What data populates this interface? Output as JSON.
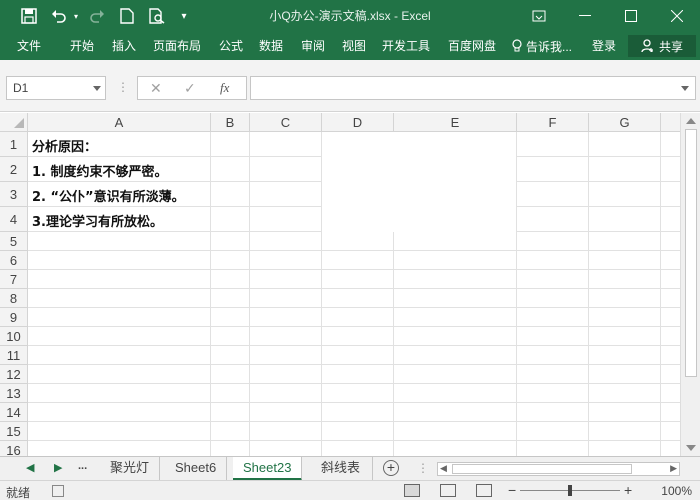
{
  "window": {
    "title": "小Q办公-演示文稿.xlsx - Excel"
  },
  "quick_access": {
    "icons": [
      "save-icon",
      "undo-icon",
      "redo-icon",
      "new-icon",
      "print-preview-icon",
      "customize-icon"
    ]
  },
  "ribbon": {
    "tabs": [
      "文件",
      "开始",
      "插入",
      "页面布局",
      "公式",
      "数据",
      "审阅",
      "视图",
      "开发工具",
      "百度网盘"
    ],
    "tell_me": "告诉我...",
    "login": "登录",
    "share": "共享"
  },
  "formula_bar": {
    "name_box": "D1",
    "fx": "fx",
    "formula": ""
  },
  "grid": {
    "columns": [
      "A",
      "B",
      "C",
      "D",
      "E",
      "F",
      "G"
    ],
    "selected_column": "D",
    "rows": [
      "1",
      "2",
      "3",
      "4",
      "5",
      "6",
      "7",
      "8",
      "9",
      "10",
      "11",
      "12",
      "13",
      "14",
      "15",
      "16"
    ],
    "cells": {
      "A1": "分析原因：",
      "A2": "1. 制度约束不够严密。",
      "A3": "2. “公仆”意识有所淡薄。",
      "A4": "3.理论学习有所放松。"
    }
  },
  "sheet_tabs": {
    "nav_more": "...",
    "tabs": [
      "聚光灯",
      "Sheet6",
      "Sheet23",
      "斜线表"
    ],
    "active": "Sheet23"
  },
  "status_bar": {
    "ready": "就绪",
    "zoom": "100%"
  }
}
